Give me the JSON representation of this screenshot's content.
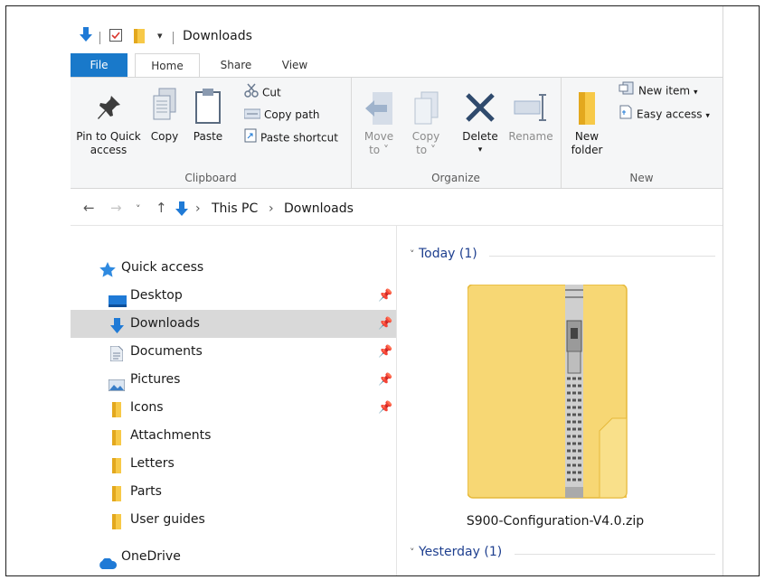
{
  "window": {
    "title": "Downloads"
  },
  "tabs": [
    "File",
    "Home",
    "Share",
    "View"
  ],
  "ribbon": {
    "clipboard": {
      "label": "Clipboard",
      "pin_line1": "Pin to Quick",
      "pin_line2": "access",
      "copy": "Copy",
      "paste": "Paste",
      "cut": "Cut",
      "copy_path": "Copy path",
      "paste_shortcut": "Paste shortcut"
    },
    "organize": {
      "label": "Organize",
      "move_line1": "Move",
      "move_line2": "to",
      "copy_line1": "Copy",
      "copy_line2": "to",
      "delete": "Delete",
      "rename": "Rename"
    },
    "new": {
      "label": "New",
      "folder_line1": "New",
      "folder_line2": "folder",
      "new_item": "New item",
      "easy_access": "Easy access"
    }
  },
  "address": {
    "crumbs": [
      "This PC",
      "Downloads"
    ]
  },
  "nav_pane": {
    "items": [
      {
        "label": "Quick access",
        "icon": "star-icon",
        "pinned": false
      },
      {
        "label": "Desktop",
        "icon": "desktop-icon",
        "pinned": true
      },
      {
        "label": "Downloads",
        "icon": "download-arrow-icon",
        "pinned": true,
        "selected": true
      },
      {
        "label": "Documents",
        "icon": "documents-icon",
        "pinned": true
      },
      {
        "label": "Pictures",
        "icon": "pictures-icon",
        "pinned": true
      },
      {
        "label": "Icons",
        "icon": "folder-icon",
        "pinned": true
      },
      {
        "label": "Attachments",
        "icon": "folder-icon",
        "pinned": false
      },
      {
        "label": "Letters",
        "icon": "folder-icon",
        "pinned": false
      },
      {
        "label": "Parts",
        "icon": "folder-icon",
        "pinned": false
      },
      {
        "label": "User guides",
        "icon": "folder-icon",
        "pinned": false
      },
      {
        "label": "OneDrive",
        "icon": "cloud-icon",
        "pinned": false
      }
    ]
  },
  "content": {
    "groups": [
      {
        "label": "Today (1)"
      },
      {
        "label": "Yesterday (1)"
      }
    ],
    "files": [
      {
        "name": "S900-Configuration-V4.0.zip",
        "icon": "zip-folder-icon"
      }
    ]
  },
  "colors": {
    "file_tab": "#1979ca",
    "group_header": "#1e3f8f",
    "selection": "#d9d9d9",
    "folder_yellow": "#f7d774",
    "download_blue": "#1f7ad6"
  }
}
